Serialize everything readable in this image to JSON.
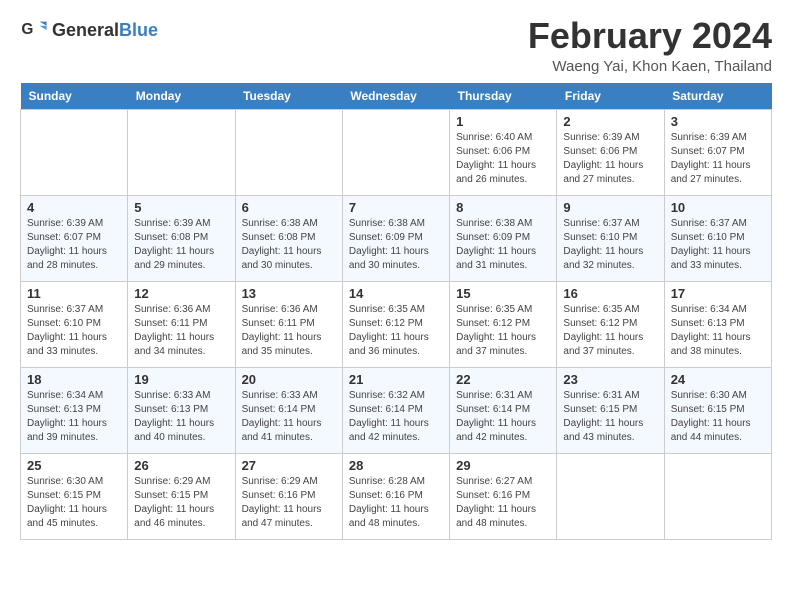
{
  "header": {
    "logo_general": "General",
    "logo_blue": "Blue",
    "month_title": "February 2024",
    "location": "Waeng Yai, Khon Kaen, Thailand"
  },
  "days_of_week": [
    "Sunday",
    "Monday",
    "Tuesday",
    "Wednesday",
    "Thursday",
    "Friday",
    "Saturday"
  ],
  "weeks": [
    [
      {
        "day": "",
        "info": ""
      },
      {
        "day": "",
        "info": ""
      },
      {
        "day": "",
        "info": ""
      },
      {
        "day": "",
        "info": ""
      },
      {
        "day": "1",
        "info": "Sunrise: 6:40 AM\nSunset: 6:06 PM\nDaylight: 11 hours\nand 26 minutes."
      },
      {
        "day": "2",
        "info": "Sunrise: 6:39 AM\nSunset: 6:06 PM\nDaylight: 11 hours\nand 27 minutes."
      },
      {
        "day": "3",
        "info": "Sunrise: 6:39 AM\nSunset: 6:07 PM\nDaylight: 11 hours\nand 27 minutes."
      }
    ],
    [
      {
        "day": "4",
        "info": "Sunrise: 6:39 AM\nSunset: 6:07 PM\nDaylight: 11 hours\nand 28 minutes."
      },
      {
        "day": "5",
        "info": "Sunrise: 6:39 AM\nSunset: 6:08 PM\nDaylight: 11 hours\nand 29 minutes."
      },
      {
        "day": "6",
        "info": "Sunrise: 6:38 AM\nSunset: 6:08 PM\nDaylight: 11 hours\nand 30 minutes."
      },
      {
        "day": "7",
        "info": "Sunrise: 6:38 AM\nSunset: 6:09 PM\nDaylight: 11 hours\nand 30 minutes."
      },
      {
        "day": "8",
        "info": "Sunrise: 6:38 AM\nSunset: 6:09 PM\nDaylight: 11 hours\nand 31 minutes."
      },
      {
        "day": "9",
        "info": "Sunrise: 6:37 AM\nSunset: 6:10 PM\nDaylight: 11 hours\nand 32 minutes."
      },
      {
        "day": "10",
        "info": "Sunrise: 6:37 AM\nSunset: 6:10 PM\nDaylight: 11 hours\nand 33 minutes."
      }
    ],
    [
      {
        "day": "11",
        "info": "Sunrise: 6:37 AM\nSunset: 6:10 PM\nDaylight: 11 hours\nand 33 minutes."
      },
      {
        "day": "12",
        "info": "Sunrise: 6:36 AM\nSunset: 6:11 PM\nDaylight: 11 hours\nand 34 minutes."
      },
      {
        "day": "13",
        "info": "Sunrise: 6:36 AM\nSunset: 6:11 PM\nDaylight: 11 hours\nand 35 minutes."
      },
      {
        "day": "14",
        "info": "Sunrise: 6:35 AM\nSunset: 6:12 PM\nDaylight: 11 hours\nand 36 minutes."
      },
      {
        "day": "15",
        "info": "Sunrise: 6:35 AM\nSunset: 6:12 PM\nDaylight: 11 hours\nand 37 minutes."
      },
      {
        "day": "16",
        "info": "Sunrise: 6:35 AM\nSunset: 6:12 PM\nDaylight: 11 hours\nand 37 minutes."
      },
      {
        "day": "17",
        "info": "Sunrise: 6:34 AM\nSunset: 6:13 PM\nDaylight: 11 hours\nand 38 minutes."
      }
    ],
    [
      {
        "day": "18",
        "info": "Sunrise: 6:34 AM\nSunset: 6:13 PM\nDaylight: 11 hours\nand 39 minutes."
      },
      {
        "day": "19",
        "info": "Sunrise: 6:33 AM\nSunset: 6:13 PM\nDaylight: 11 hours\nand 40 minutes."
      },
      {
        "day": "20",
        "info": "Sunrise: 6:33 AM\nSunset: 6:14 PM\nDaylight: 11 hours\nand 41 minutes."
      },
      {
        "day": "21",
        "info": "Sunrise: 6:32 AM\nSunset: 6:14 PM\nDaylight: 11 hours\nand 42 minutes."
      },
      {
        "day": "22",
        "info": "Sunrise: 6:31 AM\nSunset: 6:14 PM\nDaylight: 11 hours\nand 42 minutes."
      },
      {
        "day": "23",
        "info": "Sunrise: 6:31 AM\nSunset: 6:15 PM\nDaylight: 11 hours\nand 43 minutes."
      },
      {
        "day": "24",
        "info": "Sunrise: 6:30 AM\nSunset: 6:15 PM\nDaylight: 11 hours\nand 44 minutes."
      }
    ],
    [
      {
        "day": "25",
        "info": "Sunrise: 6:30 AM\nSunset: 6:15 PM\nDaylight: 11 hours\nand 45 minutes."
      },
      {
        "day": "26",
        "info": "Sunrise: 6:29 AM\nSunset: 6:15 PM\nDaylight: 11 hours\nand 46 minutes."
      },
      {
        "day": "27",
        "info": "Sunrise: 6:29 AM\nSunset: 6:16 PM\nDaylight: 11 hours\nand 47 minutes."
      },
      {
        "day": "28",
        "info": "Sunrise: 6:28 AM\nSunset: 6:16 PM\nDaylight: 11 hours\nand 48 minutes."
      },
      {
        "day": "29",
        "info": "Sunrise: 6:27 AM\nSunset: 6:16 PM\nDaylight: 11 hours\nand 48 minutes."
      },
      {
        "day": "",
        "info": ""
      },
      {
        "day": "",
        "info": ""
      }
    ]
  ]
}
